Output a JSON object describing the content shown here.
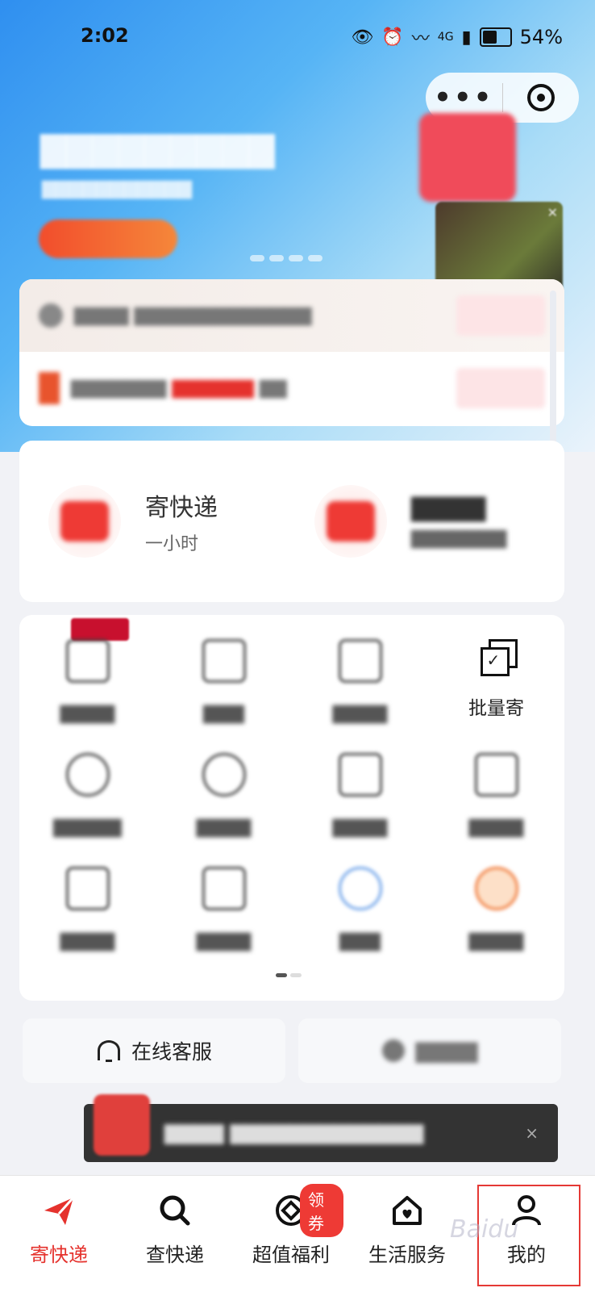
{
  "status_bar": {
    "time": "2:02",
    "network": "4G",
    "battery": "54%",
    "battery_level": 0.54
  },
  "capsule": {
    "more_label": "•••"
  },
  "main_services": {
    "send": {
      "label": "寄快递",
      "sub": "一小时"
    }
  },
  "grid": {
    "batch_label": "批量寄"
  },
  "bottom_cards": {
    "online_service": "在线客服"
  },
  "promo": {
    "close": "×"
  },
  "tabbar": {
    "items": [
      {
        "label": "寄快递",
        "icon": "paper-plane-icon",
        "active": true
      },
      {
        "label": "查快递",
        "icon": "search-icon",
        "active": false
      },
      {
        "label": "超值福利",
        "icon": "coin-icon",
        "badge": "领券",
        "active": false
      },
      {
        "label": "生活服务",
        "icon": "house-heart-icon",
        "active": false
      },
      {
        "label": "我的",
        "icon": "user-icon",
        "active": false
      }
    ]
  },
  "watermark": "Baidu",
  "colors": {
    "accent_red": "#e5322d",
    "scroll_blue": "#1f5ed8",
    "header_gradient_start": "#2f8ff0"
  }
}
